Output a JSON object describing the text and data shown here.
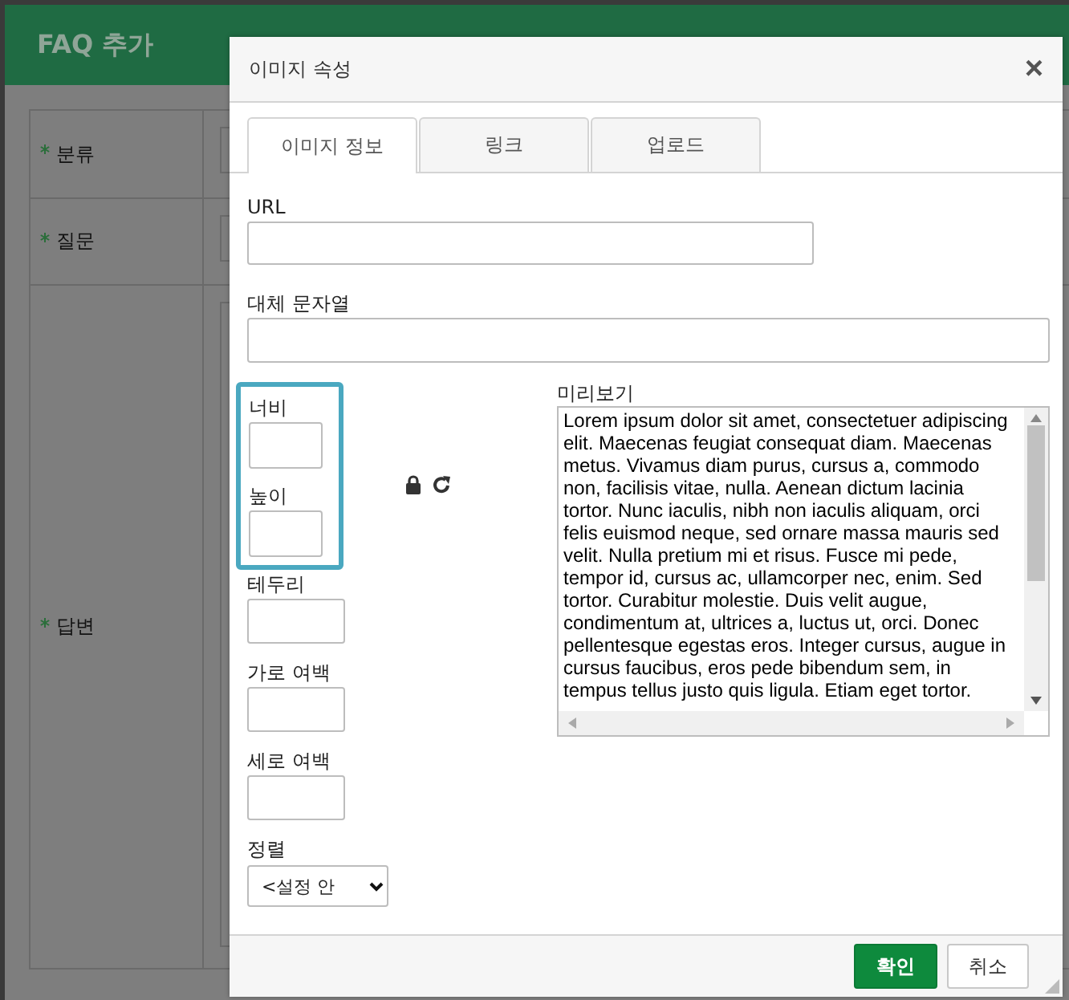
{
  "page": {
    "title": "FAQ 추가",
    "form_rows": [
      {
        "label": "분류",
        "required": true
      },
      {
        "label": "질문",
        "required": true
      },
      {
        "label": "답변",
        "required": true
      }
    ]
  },
  "dialog": {
    "title": "이미지 속성",
    "close": "×",
    "tabs": [
      {
        "label": "이미지 정보",
        "selected": true
      },
      {
        "label": "링크",
        "selected": false
      },
      {
        "label": "업로드",
        "selected": false
      }
    ],
    "url_label": "URL",
    "alt_label": "대체 문자열",
    "width_label": "너비",
    "height_label": "높이",
    "border_label": "테두리",
    "hspace_label": "가로 여백",
    "vspace_label": "세로 여백",
    "align_label": "정렬",
    "align_value": "<설정 안",
    "preview_label": "미리보기",
    "preview_text": "Lorem ipsum dolor sit amet, consectetuer adipiscing elit. Maecenas feugiat consequat diam. Maecenas metus. Vivamus diam purus, cursus a, commodo non, facilisis vitae, nulla. Aenean dictum lacinia tortor. Nunc iaculis, nibh non iaculis aliquam, orci felis euismod neque, sed ornare massa mauris sed velit. Nulla pretium mi et risus. Fusce mi pede, tempor id, cursus ac, ullamcorper nec, enim. Sed tortor. Curabitur molestie. Duis velit augue, condimentum at, ultrices a, luctus ut, orci. Donec pellentesque egestas eros. Integer cursus, augue in cursus faucibus, eros pede bibendum sem, in tempus tellus justo quis ligula. Etiam eget tortor.",
    "ok": "확인",
    "cancel": "취소"
  }
}
